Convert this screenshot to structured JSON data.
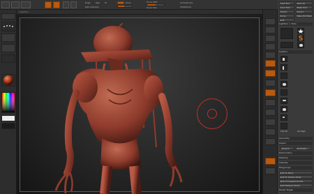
{
  "top_toolbar": {
    "tool_mode_buttons": [
      "Edit",
      "Draw",
      "Move",
      "Scale",
      "Rotate"
    ],
    "mrgb_label": "Mrgb",
    "rgb_label": "Rgb",
    "m_label": "M",
    "zadd_label": "Zadd",
    "zsub_label": "Zsub",
    "rgb_intensity_label": "Rgb Intensity",
    "z_intensity_label": "Z Intensity",
    "focal_shift_label": "Focal Shift",
    "draw_size_label": "Draw Size",
    "active_points_label": "ActivePoints",
    "total_points_label": "TotalPoints"
  },
  "subbar": {
    "menu_label": "Lightbox"
  },
  "canvas": {
    "background_gradient": [
      "#3d3d3d",
      "#141414"
    ],
    "subject": "sculpted alien creature model",
    "subject_color": "#8e3b2c",
    "brush_color": "#c0302a"
  },
  "right_tray": {
    "load_tool": "Load Tool",
    "save_as": "Save As",
    "copy_tool": "Copy Tool",
    "paste_tool": "Paste Tool",
    "import": "Import",
    "export": "Export",
    "clone": "Clone",
    "make_polymesh": "Make PolyMesh3D",
    "goz": "GoZ",
    "lightbox_tools": "Lightbox > Tools",
    "subtools_label": "SubTool",
    "geometry": "Geometry",
    "layers": "Layers",
    "deformation": "Deformation",
    "masking": "Masking",
    "visibility": "Visibility",
    "polygroups": "Polygroups",
    "contact": "Contact",
    "morph_target": "Morph Target",
    "polypaint": "Polypaint",
    "uv_map": "UV Map",
    "texture_map": "Texture Map",
    "displacement_map": "Displacement Map",
    "normal_map": "Normal Map",
    "list_all": "List All",
    "all_high": "All High",
    "all_low": "All Low",
    "append": "Append",
    "duplicate": "Duplicate",
    "split_to_parts": "Split To Parts",
    "split_to_similar_parts": "Split To Similar Parts",
    "split_unmasked_points": "Split Unmasked Points",
    "split_masked_points": "Split Masked Points"
  },
  "colors": {
    "accent": "#b85a12",
    "panel": "#3a3a3a",
    "shelf": "#2d2d2d"
  }
}
